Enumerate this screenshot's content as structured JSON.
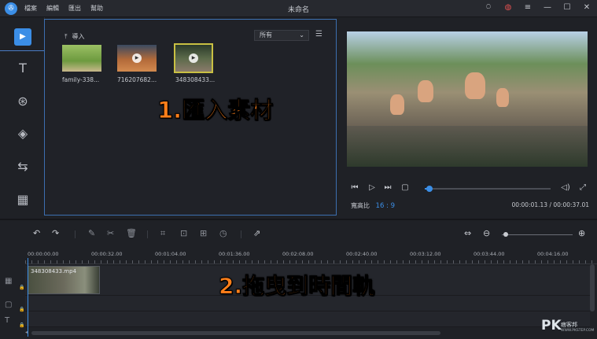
{
  "window": {
    "title": "未命名",
    "menu": [
      "檔案",
      "編輯",
      "匯出",
      "幫助"
    ],
    "controls": [
      "user-icon",
      "message-icon",
      "menu-icon",
      "minimize-icon",
      "maximize-icon",
      "close-icon"
    ]
  },
  "sidebar": {
    "items": [
      "media-icon",
      "text-icon",
      "filter-icon",
      "overlay-icon",
      "transition-icon",
      "film-icon"
    ]
  },
  "library": {
    "import_label": "導入",
    "filter_value": "所有",
    "items": [
      {
        "label": "family-338..."
      },
      {
        "label": "716207682..."
      },
      {
        "label": "348308433..."
      }
    ]
  },
  "annotations": {
    "step1": "1.匯入素材",
    "step2": "2.拖曳到時間軌"
  },
  "preview": {
    "aspect_label": "寬高比",
    "aspect_value": "16 : 9",
    "timecode": "00:00:01.13 / 00:00:37.01",
    "progress": 0.04
  },
  "timeline": {
    "ruler": [
      "00:00:00.00",
      "00:00:32.00",
      "00:01:04.00",
      "00:01:36.00",
      "00:02:08.00",
      "00:02:40.00",
      "00:03:12.00",
      "00:03:44.00",
      "00:04:16.00"
    ],
    "clip_label": "348308433.mp4",
    "zoom": 0.05
  },
  "watermark": {
    "brand": "PK",
    "sub": "痞客邦",
    "en": "WWW.PKSTEP.COM"
  },
  "colors": {
    "accent": "#3b8ee6",
    "annotation": "#ff7f1a",
    "selection": "#c9c043"
  }
}
